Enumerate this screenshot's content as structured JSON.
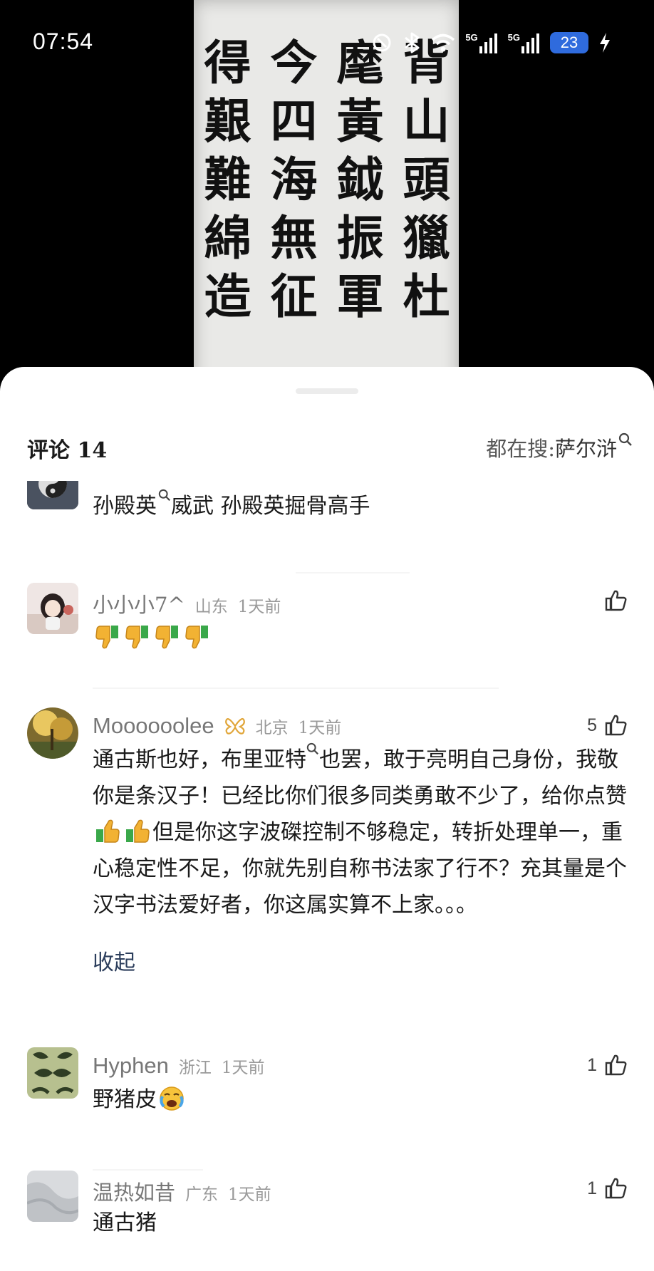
{
  "status_bar": {
    "time": "07:54",
    "signal_1_label": "5G",
    "signal_2_label": "5G",
    "battery": "23"
  },
  "video": {
    "calligraphy_rows": [
      [
        "得",
        "今",
        "麾",
        "背"
      ],
      [
        "艱",
        "四",
        "黃",
        "山"
      ],
      [
        "難",
        "海",
        "鉞",
        "頭"
      ],
      [
        "綿",
        "無",
        "振",
        "獵"
      ],
      [
        "造",
        "征",
        "軍",
        "杜"
      ]
    ]
  },
  "sheet": {
    "title": "评论 14",
    "hot_search_label": "都在搜:",
    "hot_search_term": "萨尔浒"
  },
  "comments": [
    {
      "username": "",
      "body_part1": "孙殿英",
      "body_part2": "威武  孙殿英掘骨高手",
      "like_count": ""
    },
    {
      "username": "小小小7^",
      "location": "山东",
      "time_ago": "1天前",
      "like_count": "",
      "emojis": [
        "thumbs-down",
        "thumbs-down",
        "thumbs-down",
        "thumbs-down"
      ]
    },
    {
      "username": "Moooooolee",
      "location": "北京",
      "time_ago": "1天前",
      "like_count": "5",
      "body_a": "通古斯也好，布里亚特",
      "body_b": "也罢，敢于亮明自己身份，我敬你是条汉子！已经比你们很多同类勇敢不少了，给你点赞",
      "body_c": "但是你这字波磔控制不够稳定，转折处理单一，重心稳定性不足，你就先别自称书法家了行不？充其量是个汉字书法爱好者，你这属实算不上家。。。",
      "collapse_label": "收起"
    },
    {
      "username": "Hyphen",
      "location": "浙江",
      "time_ago": "1天前",
      "like_count": "1",
      "body": "野猪皮"
    },
    {
      "username": "温热如昔",
      "location": "广东",
      "time_ago": "1天前",
      "like_count": "1",
      "body": "通古猪"
    }
  ],
  "colors": {
    "accent_blue": "#2f6bdd",
    "muted_text": "#9a9a9a",
    "link_text": "#2c3e5c"
  }
}
